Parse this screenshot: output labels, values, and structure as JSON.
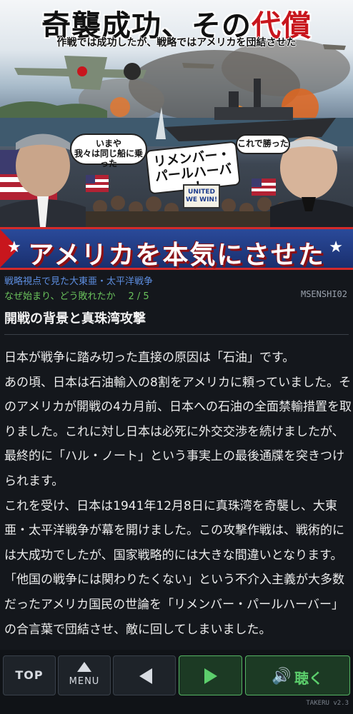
{
  "hero": {
    "title_main": "奇襲成功、その",
    "title_accent": "代償",
    "subtitle": "作戦では成功したが、戦略ではアメリカを団結させた",
    "bubble_left": "いまや\n我々は同じ船に乗った",
    "bubble_center": "リメンバー・\nパールハーバー！",
    "bubble_right": "これで勝った",
    "sign_text": "UNITED\nWE WIN!",
    "banner_text": "アメリカを本気にさせた"
  },
  "meta": {
    "series": "戦略視点で見た大東亜・太平洋戦争",
    "subtitle": "なぜ始まり、どう敗れたか",
    "page": "2 / 5",
    "code": "MSENSHI02"
  },
  "chapter": {
    "title": "開戦の背景と真珠湾攻撃"
  },
  "body": {
    "paragraphs": [
      "日本が戦争に踏み切った直接の原因は「石油」です。",
      "あの頃、日本は石油輸入の8割をアメリカに頼っていました。そのアメリカが開戦の4カ月前、日本への石油の全面禁輸措置を取りました。これに対し日本は必死に外交交渉を続けましたが、最終的に「ハル・ノート」という事実上の最後通牒を突きつけられます。",
      "これを受け、日本は1941年12月8日に真珠湾を奇襲し、大東亜・太平洋戦争が幕を開けました。この攻撃作戦は、戦術的には大成功でしたが、国家戦略的には大きな間違いとなります。",
      "「他国の戦争には関わりたくない」という不介入主義が大多数だったアメリカ国民の世論を「リメンバー・パールハーバー」の合言葉で団結させ、敵に回してしまいました。"
    ]
  },
  "nav": {
    "top_label": "TOP",
    "menu_label": "MENU",
    "listen_label": "聴く",
    "version": "TAKERU v2.3"
  },
  "colors": {
    "accent_red": "#c8161d",
    "series_blue": "#5d8ee0",
    "sub_green": "#6ac35c",
    "active_green": "#5ccf6c"
  }
}
